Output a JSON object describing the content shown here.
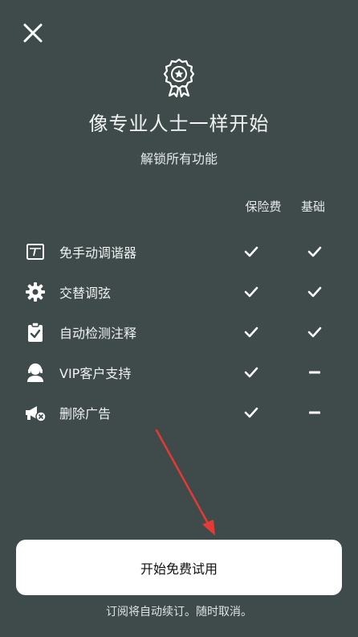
{
  "header": {
    "close_icon": "close-icon",
    "badge_icon": "award-ribbon-icon",
    "title": "像专业人士一样开始",
    "subtitle": "解锁所有功能"
  },
  "columns": {
    "premium": "保险费",
    "basic": "基础"
  },
  "features": [
    {
      "label": "免手动调谐器",
      "icon": "tuner-icon",
      "premium": "check",
      "basic": "check"
    },
    {
      "label": "交替调弦",
      "icon": "gear-icon",
      "premium": "check",
      "basic": "check"
    },
    {
      "label": "自动检测注释",
      "icon": "clipboard-check-icon",
      "premium": "check",
      "basic": "check"
    },
    {
      "label": "VIP客户支持",
      "icon": "support-agent-icon",
      "premium": "check",
      "basic": "dash"
    },
    {
      "label": "删除广告",
      "icon": "megaphone-remove-icon",
      "premium": "check",
      "basic": "dash"
    }
  ],
  "cta": {
    "label": "开始免费试用"
  },
  "footnote": "订阅将自动续订。随时取消。",
  "colors": {
    "background": "#3e4b4a",
    "button": "#ffffff",
    "arrow": "#e53935"
  }
}
